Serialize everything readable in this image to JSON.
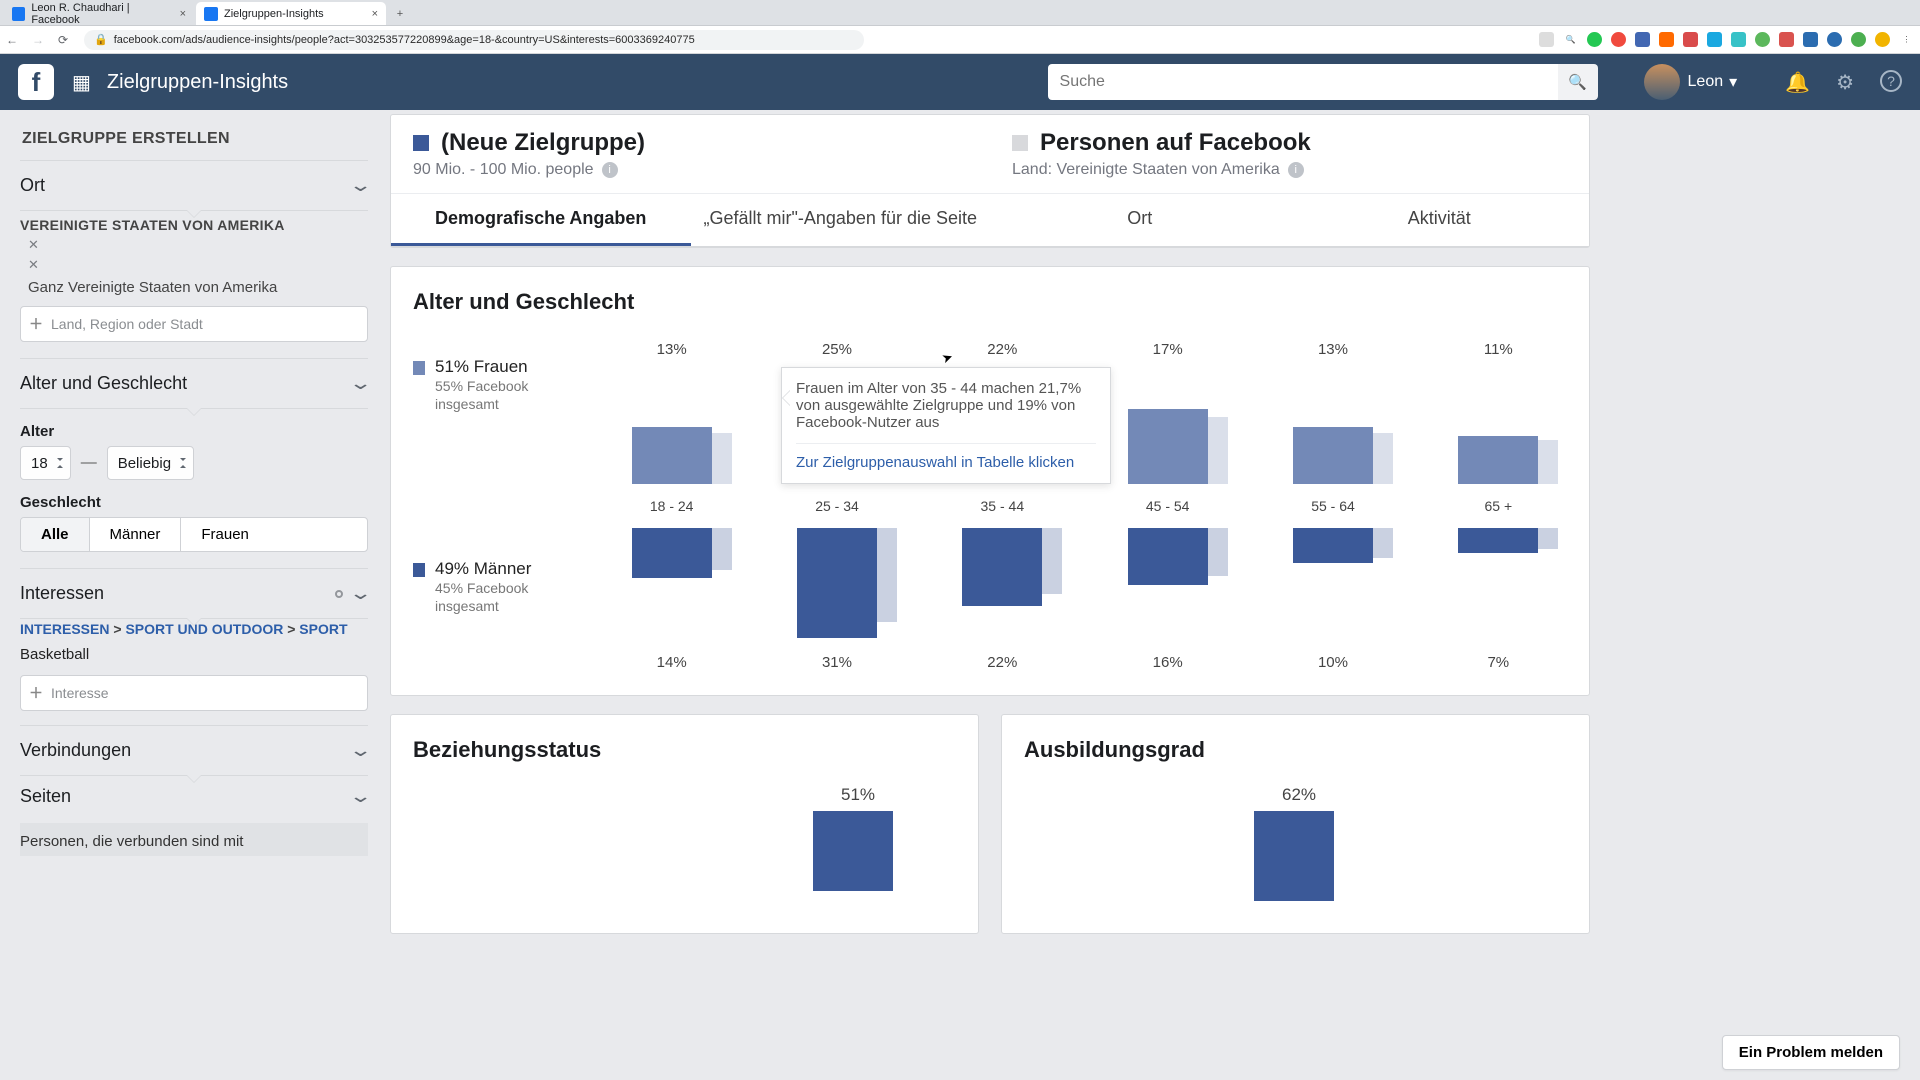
{
  "browser": {
    "tabs": [
      {
        "title": "Leon R. Chaudhari | Facebook"
      },
      {
        "title": "Zielgruppen-Insights"
      }
    ],
    "url": "facebook.com/ads/audience-insights/people?act=303253577220899&age=18-&country=US&interests=6003369240775"
  },
  "topbar": {
    "app_title": "Zielgruppen-Insights",
    "search_placeholder": "Suche",
    "user_name": "Leon"
  },
  "sidebar": {
    "title": "ZIELGRUPPE ERSTELLEN",
    "panels": {
      "ort": "Ort",
      "country_header": "VEREINIGTE STAATEN VON AMERIKA",
      "country_sub": "Ganz Vereinigte Staaten von Amerika",
      "place_placeholder": "Land, Region oder Stadt",
      "age_gender": "Alter und Geschlecht",
      "age_label": "Alter",
      "age_from": "18",
      "age_to": "Beliebig",
      "gender_label": "Geschlecht",
      "gender_options": [
        "Alle",
        "Männer",
        "Frauen"
      ],
      "interests": "Interessen",
      "breadcrumb_1": "INTERESSEN",
      "breadcrumb_2": "SPORT UND OUTDOOR",
      "breadcrumb_3": "SPORT",
      "interest_name": "Basketball",
      "interest_placeholder": "Interesse",
      "connections": "Verbindungen",
      "pages": "Seiten",
      "connected_with": "Personen, die verbunden sind mit"
    }
  },
  "audiences": {
    "new": {
      "title": "(Neue Zielgruppe)",
      "sub": "90 Mio. - 100 Mio. people"
    },
    "fb": {
      "title": "Personen auf Facebook",
      "sub": "Land: Vereinigte Staaten von Amerika"
    }
  },
  "tabs": {
    "demographics": "Demografische Angaben",
    "likes": "„Gefällt mir\"-Angaben für die Seite",
    "location": "Ort",
    "activity": "Aktivität"
  },
  "chart_title": "Alter und Geschlecht",
  "legend": {
    "women_pct": "51% Frauen",
    "women_sub": "55% Facebook insgesamt",
    "men_pct": "49% Männer",
    "men_sub": "45% Facebook insgesamt"
  },
  "tooltip": {
    "text": "Frauen im Alter von 35 - 44 machen 21,7% von ausgewählte Zielgruppe und 19% von Facebook-Nutzer aus",
    "link": "Zur Zielgruppenauswahl in Tabelle klicken"
  },
  "bottom": {
    "relationship_title": "Beziehungsstatus",
    "relationship_pct": "51%",
    "education_title": "Ausbildungsgrad",
    "education_pct": "62%"
  },
  "problem_btn": "Ein Problem melden",
  "chart_data": {
    "type": "bar",
    "title": "Alter und Geschlecht",
    "categories": [
      "18 - 24",
      "25 - 34",
      "35 - 44",
      "45 - 54",
      "55 - 64",
      "65 +"
    ],
    "series": [
      {
        "name": "Frauen",
        "values": [
          13,
          25,
          22,
          17,
          13,
          11
        ]
      },
      {
        "name": "Männer",
        "values": [
          14,
          31,
          22,
          16,
          10,
          7
        ]
      }
    ],
    "ylabel": "%"
  }
}
